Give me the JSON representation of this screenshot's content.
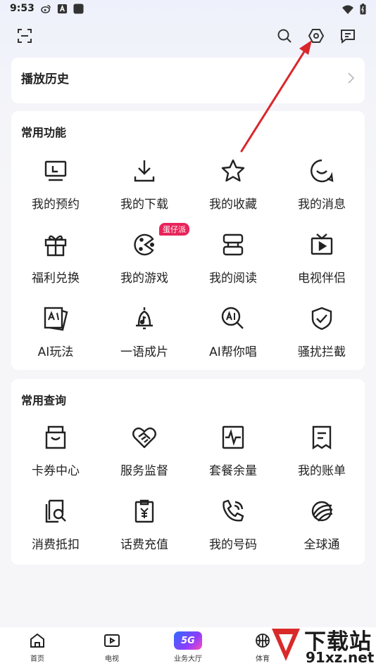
{
  "status_bar": {
    "time": "9:53",
    "left_icons": [
      "weibo-icon",
      "a-app-icon",
      "app-square-icon"
    ],
    "right_icons": [
      "wifi-icon",
      "battery-icon"
    ]
  },
  "top_bar": {
    "left_icons": [
      "scan-icon"
    ],
    "right_icons": [
      "search-icon",
      "settings-hexagon-icon",
      "message-icon"
    ]
  },
  "history": {
    "title": "播放历史"
  },
  "common_functions": {
    "title": "常用功能",
    "items": [
      {
        "label": "我的预约",
        "icon": "monitor-icon"
      },
      {
        "label": "我的下载",
        "icon": "download-icon"
      },
      {
        "label": "我的收藏",
        "icon": "star-icon"
      },
      {
        "label": "我的消息",
        "icon": "smile-message-icon"
      },
      {
        "label": "福利兑换",
        "icon": "gift-icon"
      },
      {
        "label": "我的游戏",
        "icon": "game-icon"
      },
      {
        "label": "我的阅读",
        "icon": "reading-icon"
      },
      {
        "label": "电视伴侣",
        "icon": "tv-icon"
      },
      {
        "label": "AI玩法",
        "icon": "ai-cards-icon"
      },
      {
        "label": "一语成片",
        "icon": "bell-note-icon"
      },
      {
        "label": "AI帮你唱",
        "icon": "ai-search-icon"
      },
      {
        "label": "骚扰拦截",
        "icon": "shield-check-icon"
      }
    ],
    "badge": "蛋仔派"
  },
  "common_queries": {
    "title": "常用查询",
    "items": [
      {
        "label": "卡券中心",
        "icon": "coupon-icon"
      },
      {
        "label": "服务监督",
        "icon": "handshake-heart-icon"
      },
      {
        "label": "套餐余量",
        "icon": "pulse-chart-icon"
      },
      {
        "label": "我的账单",
        "icon": "bill-icon"
      },
      {
        "label": "消费抵扣",
        "icon": "doc-search-icon"
      },
      {
        "label": "话费充值",
        "icon": "yuan-clipboard-icon"
      },
      {
        "label": "我的号码",
        "icon": "phone-call-icon"
      },
      {
        "label": "全球通",
        "icon": "globe-swoosh-icon"
      }
    ]
  },
  "bottom_nav": {
    "items": [
      {
        "label": "首页",
        "icon": "home-icon"
      },
      {
        "label": "电视",
        "icon": "play-tv-icon"
      },
      {
        "label": "业务大厅",
        "icon": "5g-icon",
        "icon_text": "5G"
      },
      {
        "label": "体育",
        "icon": "basketball-icon"
      }
    ]
  },
  "watermark": {
    "title": "下载站",
    "sub": "91xz.net"
  },
  "colors": {
    "accent_red": "#e8245a",
    "arrow_red": "#d9262b",
    "text": "#222222",
    "background": "#f6f6f8",
    "card": "#ffffff"
  }
}
